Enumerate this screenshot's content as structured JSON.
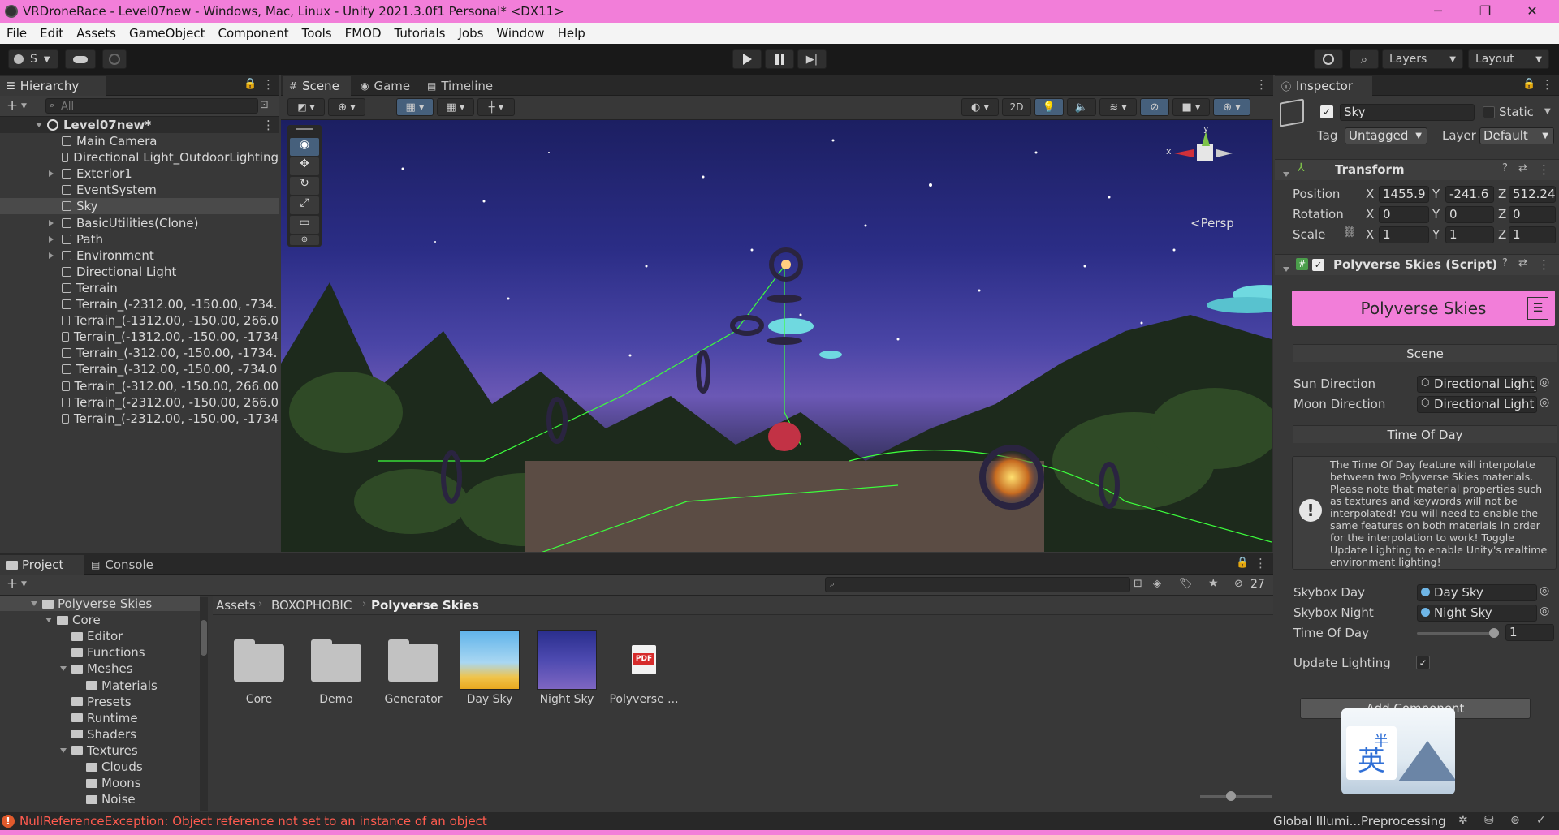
{
  "window": {
    "title": "VRDroneRace - Level07new - Windows, Mac, Linux - Unity 2021.3.0f1 Personal* <DX11>",
    "controls": [
      "─",
      "❐",
      "✕"
    ]
  },
  "menu": [
    "File",
    "Edit",
    "Assets",
    "GameObject",
    "Component",
    "Tools",
    "FMOD",
    "Tutorials",
    "Jobs",
    "Window",
    "Help"
  ],
  "toolbar": {
    "account": "S",
    "layers": "Layers",
    "layout": "Layout"
  },
  "hierarchy": {
    "tab": "Hierarchy",
    "search_placeholder": "All",
    "scene": "Level07new*",
    "items": [
      {
        "label": "Main Camera",
        "expandable": false
      },
      {
        "label": "Directional Light_OutdoorLighting",
        "expandable": false
      },
      {
        "label": "Exterior1",
        "expandable": true
      },
      {
        "label": "EventSystem",
        "expandable": false
      },
      {
        "label": "Sky",
        "expandable": false,
        "selected": true
      },
      {
        "label": "BasicUtilities(Clone)",
        "expandable": true
      },
      {
        "label": "Path",
        "expandable": true
      },
      {
        "label": "Environment",
        "expandable": true
      },
      {
        "label": "Directional Light",
        "expandable": false
      },
      {
        "label": "Terrain",
        "expandable": false
      },
      {
        "label": "Terrain_(-2312.00, -150.00, -734.",
        "expandable": false
      },
      {
        "label": "Terrain_(-1312.00, -150.00, 266.0",
        "expandable": false
      },
      {
        "label": "Terrain_(-1312.00, -150.00, -1734",
        "expandable": false
      },
      {
        "label": "Terrain_(-312.00, -150.00, -1734.",
        "expandable": false
      },
      {
        "label": "Terrain_(-312.00, -150.00, -734.0",
        "expandable": false
      },
      {
        "label": "Terrain_(-312.00, -150.00, 266.00",
        "expandable": false
      },
      {
        "label": "Terrain_(-2312.00, -150.00, 266.0",
        "expandable": false
      },
      {
        "label": "Terrain_(-2312.00, -150.00, -1734",
        "expandable": false
      }
    ]
  },
  "scene_view": {
    "tabs": [
      "Scene",
      "Game",
      "Timeline"
    ],
    "mode_2d": "2D",
    "persp": "<Persp",
    "gizmo_axes": {
      "y": "y",
      "x": "x"
    }
  },
  "inspector": {
    "tab": "Inspector",
    "object_name": "Sky",
    "static_label": "Static",
    "tag_label": "Tag",
    "tag_value": "Untagged",
    "layer_label": "Layer",
    "layer_value": "Default",
    "transform": {
      "title": "Transform",
      "position_label": "Position",
      "position": {
        "x": "1455.9",
        "y": "-241.6",
        "z": "512.24"
      },
      "rotation_label": "Rotation",
      "rotation": {
        "x": "0",
        "y": "0",
        "z": "0"
      },
      "scale_label": "Scale",
      "scale": {
        "x": "1",
        "y": "1",
        "z": "1"
      }
    },
    "script": {
      "title": "Polyverse Skies (Script)",
      "banner": "Polyverse Skies",
      "banner_color": "#f27ed9",
      "scene_section": "Scene",
      "sun_direction_label": "Sun Direction",
      "sun_direction_value": "Directional Light_(",
      "moon_direction_label": "Moon Direction",
      "moon_direction_value": "Directional Light",
      "time_section": "Time Of Day",
      "info_text": "The Time Of Day feature will interpolate between two Polyverse Skies materials. Please note that material properties such as textures and keywords will not be interpolated! You will need to enable the same features on both materials in order for the interpolation to work! Toggle Update Lighting to enable Unity's realtime environment lighting!",
      "skybox_day_label": "Skybox Day",
      "skybox_day_value": "Day Sky",
      "skybox_night_label": "Skybox Night",
      "skybox_night_value": "Night Sky",
      "time_of_day_label": "Time Of Day",
      "time_of_day_value": "1",
      "update_lighting_label": "Update Lighting",
      "update_lighting_checked": true
    },
    "add_component": "Add Component"
  },
  "project": {
    "tabs": [
      "Project",
      "Console"
    ],
    "hidden_count": "27",
    "breadcrumb": [
      "Assets",
      "BOXOPHOBIC",
      "Polyverse Skies"
    ],
    "tree": [
      {
        "label": "Polyverse Skies",
        "depth": 0,
        "open": true
      },
      {
        "label": "Core",
        "depth": 1,
        "open": true
      },
      {
        "label": "Editor",
        "depth": 2,
        "open": false
      },
      {
        "label": "Functions",
        "depth": 2,
        "open": false
      },
      {
        "label": "Meshes",
        "depth": 2,
        "open": true
      },
      {
        "label": "Materials",
        "depth": 3,
        "open": false
      },
      {
        "label": "Presets",
        "depth": 2,
        "open": false
      },
      {
        "label": "Runtime",
        "depth": 2,
        "open": false
      },
      {
        "label": "Shaders",
        "depth": 2,
        "open": false
      },
      {
        "label": "Textures",
        "depth": 2,
        "open": true
      },
      {
        "label": "Clouds",
        "depth": 3,
        "open": false
      },
      {
        "label": "Moons",
        "depth": 3,
        "open": false
      },
      {
        "label": "Noise",
        "depth": 3,
        "open": false
      }
    ],
    "assets": [
      "Core",
      "Demo",
      "Generator",
      "Day Sky",
      "Night Sky",
      "Polyverse ..."
    ]
  },
  "status": {
    "error": "NullReferenceException: Object reference not set to an instance of an object",
    "right": "Global Illumi...Preprocessing"
  },
  "overlay": {
    "logo_text": "英",
    "logo_text2": "半"
  }
}
